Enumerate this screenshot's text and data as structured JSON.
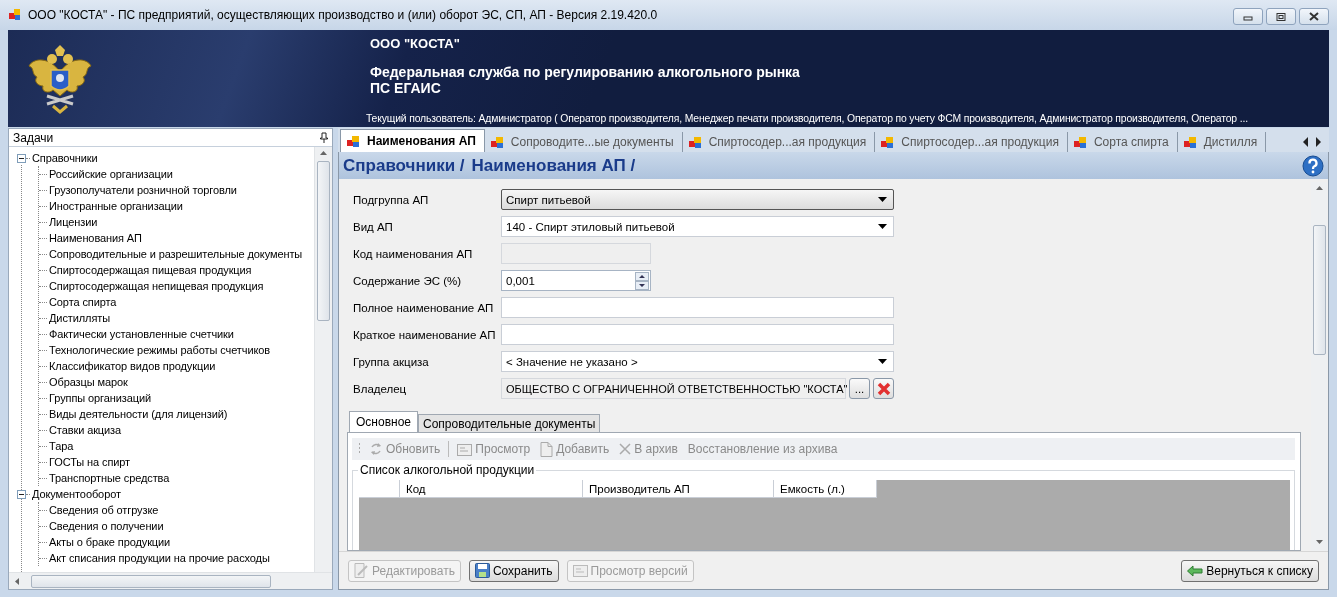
{
  "window": {
    "title": "ООО \"КОСТА\" - ПС предприятий, осуществляющих производство и (или) оборот ЭС, СП, АП - Версия 2.19.420.0"
  },
  "banner": {
    "organization": "ООО \"КОСТА\"",
    "agency": "Федеральная служба по регулированию алкогольного рынка",
    "system": "ПС ЕГАИС",
    "current_user": "Текущий пользователь: Администратор ( Оператор производителя, Менеджер печати производителя, Оператор по учету ФСМ производителя, Администратор производителя, Оператор ..."
  },
  "tasks": {
    "title": "Задачи",
    "tree": [
      {
        "label": "Справочники",
        "expanded": true,
        "children": [
          {
            "label": "Российские организации"
          },
          {
            "label": "Грузополучатели розничной торговли"
          },
          {
            "label": "Иностранные организации"
          },
          {
            "label": "Лицензии"
          },
          {
            "label": "Наименования АП"
          },
          {
            "label": "Сопроводительные и разрешительные документы"
          },
          {
            "label": "Спиртосодержащая пищевая продукция"
          },
          {
            "label": "Спиртосодержащая непищевая продукция"
          },
          {
            "label": "Сорта спирта"
          },
          {
            "label": "Дистилляты"
          },
          {
            "label": "Фактически установленные счетчики"
          },
          {
            "label": "Технологические режимы работы счетчиков"
          },
          {
            "label": "Классификатор видов продукции"
          },
          {
            "label": "Образцы марок"
          },
          {
            "label": "Группы организаций"
          },
          {
            "label": "Виды деятельности (для лицензий)"
          },
          {
            "label": "Ставки акциза"
          },
          {
            "label": "Тара"
          },
          {
            "label": "ГОСТы на спирт"
          },
          {
            "label": "Транспортные средства"
          }
        ]
      },
      {
        "label": "Документооборот",
        "expanded": true,
        "children": [
          {
            "label": "Сведения об отгрузке"
          },
          {
            "label": "Сведения о получении"
          },
          {
            "label": "Акты о браке продукции"
          },
          {
            "label": "Акт списания продукции на прочие расходы"
          }
        ]
      }
    ]
  },
  "tabs": [
    {
      "label": "Наименования АП",
      "selected": true
    },
    {
      "label": "Сопроводите...ые документы",
      "selected": false
    },
    {
      "label": "Спиртосодер...ая продукция",
      "selected": false
    },
    {
      "label": "Спиртосодер...ая продукция",
      "selected": false
    },
    {
      "label": "Сорта спирта",
      "selected": false
    },
    {
      "label": "Дистилля",
      "selected": false
    }
  ],
  "breadcrumb": [
    "Справочники /",
    "Наименования АП /"
  ],
  "fields": [
    {
      "kind": "select",
      "label": "Подгруппа АП",
      "value": "Спирт питьевой",
      "focused": true
    },
    {
      "kind": "select",
      "label": "Вид АП",
      "value": "140 - Спирт этиловый питьевой",
      "focused": false
    },
    {
      "kind": "text",
      "label": "Код наименования АП",
      "disabled": true
    },
    {
      "kind": "spin",
      "label": "Содержание ЭС (%)",
      "value": "0,001"
    },
    {
      "kind": "text",
      "label": "Полное наименование АП",
      "disabled": false
    },
    {
      "kind": "text",
      "label": "Краткое наименование АП",
      "disabled": false
    },
    {
      "kind": "select",
      "label": "Группа акциза",
      "value": "< Значение не указано >",
      "focused": false
    },
    {
      "kind": "lookup",
      "label": "Владелец",
      "value": "ОБЩЕСТВО С ОГРАНИЧЕННОЙ ОТВЕТСТВЕННОСТЬЮ \"КОСТА\"",
      "browse": "..."
    }
  ],
  "subtabs": [
    {
      "label": "Основное",
      "selected": true
    },
    {
      "label": "Сопроводительные документы",
      "selected": false
    }
  ],
  "toolbar": [
    {
      "label": "Обновить",
      "disabled": true
    },
    {
      "label": "Просмотр",
      "disabled": true
    },
    {
      "label": "Добавить",
      "disabled": true
    },
    {
      "label": "В архив",
      "disabled": true
    },
    {
      "label": "Восстановление из архива",
      "disabled": true
    }
  ],
  "product_list": {
    "title": "Список алкогольной продукции",
    "columns": [
      "Код",
      "Производитель АП",
      "Емкость (л.)"
    ]
  },
  "footer_buttons": [
    {
      "label": "Редактировать",
      "disabled": true
    },
    {
      "label": "Сохранить",
      "disabled": false
    },
    {
      "label": "Просмотр версий",
      "disabled": true
    }
  ],
  "back_button": {
    "label": "Вернуться к списку"
  }
}
